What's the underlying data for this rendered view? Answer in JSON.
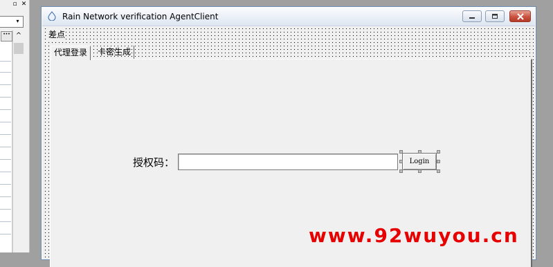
{
  "side_panel": {
    "restore_glyph": "▫",
    "close_glyph": "✕",
    "combo_arrow": "▾",
    "dots_glyph": "···",
    "scroll_up_glyph": "^"
  },
  "window": {
    "title": "Rain Network verification AgentClient",
    "icon": "app-icon",
    "buttons": {
      "minimize": "minimize-icon",
      "maximize": "maximize-icon",
      "close": "close-icon"
    }
  },
  "menu": {
    "items": [
      "差点"
    ]
  },
  "tabs": [
    {
      "label": "代理登录",
      "active": true
    },
    {
      "label": "卡密生成",
      "active": false
    }
  ],
  "form": {
    "auth_label": "授权码：",
    "auth_value": "",
    "login_label": "Login"
  },
  "watermark": {
    "text": "www.92wuyou.cn",
    "color": "#e60000"
  }
}
